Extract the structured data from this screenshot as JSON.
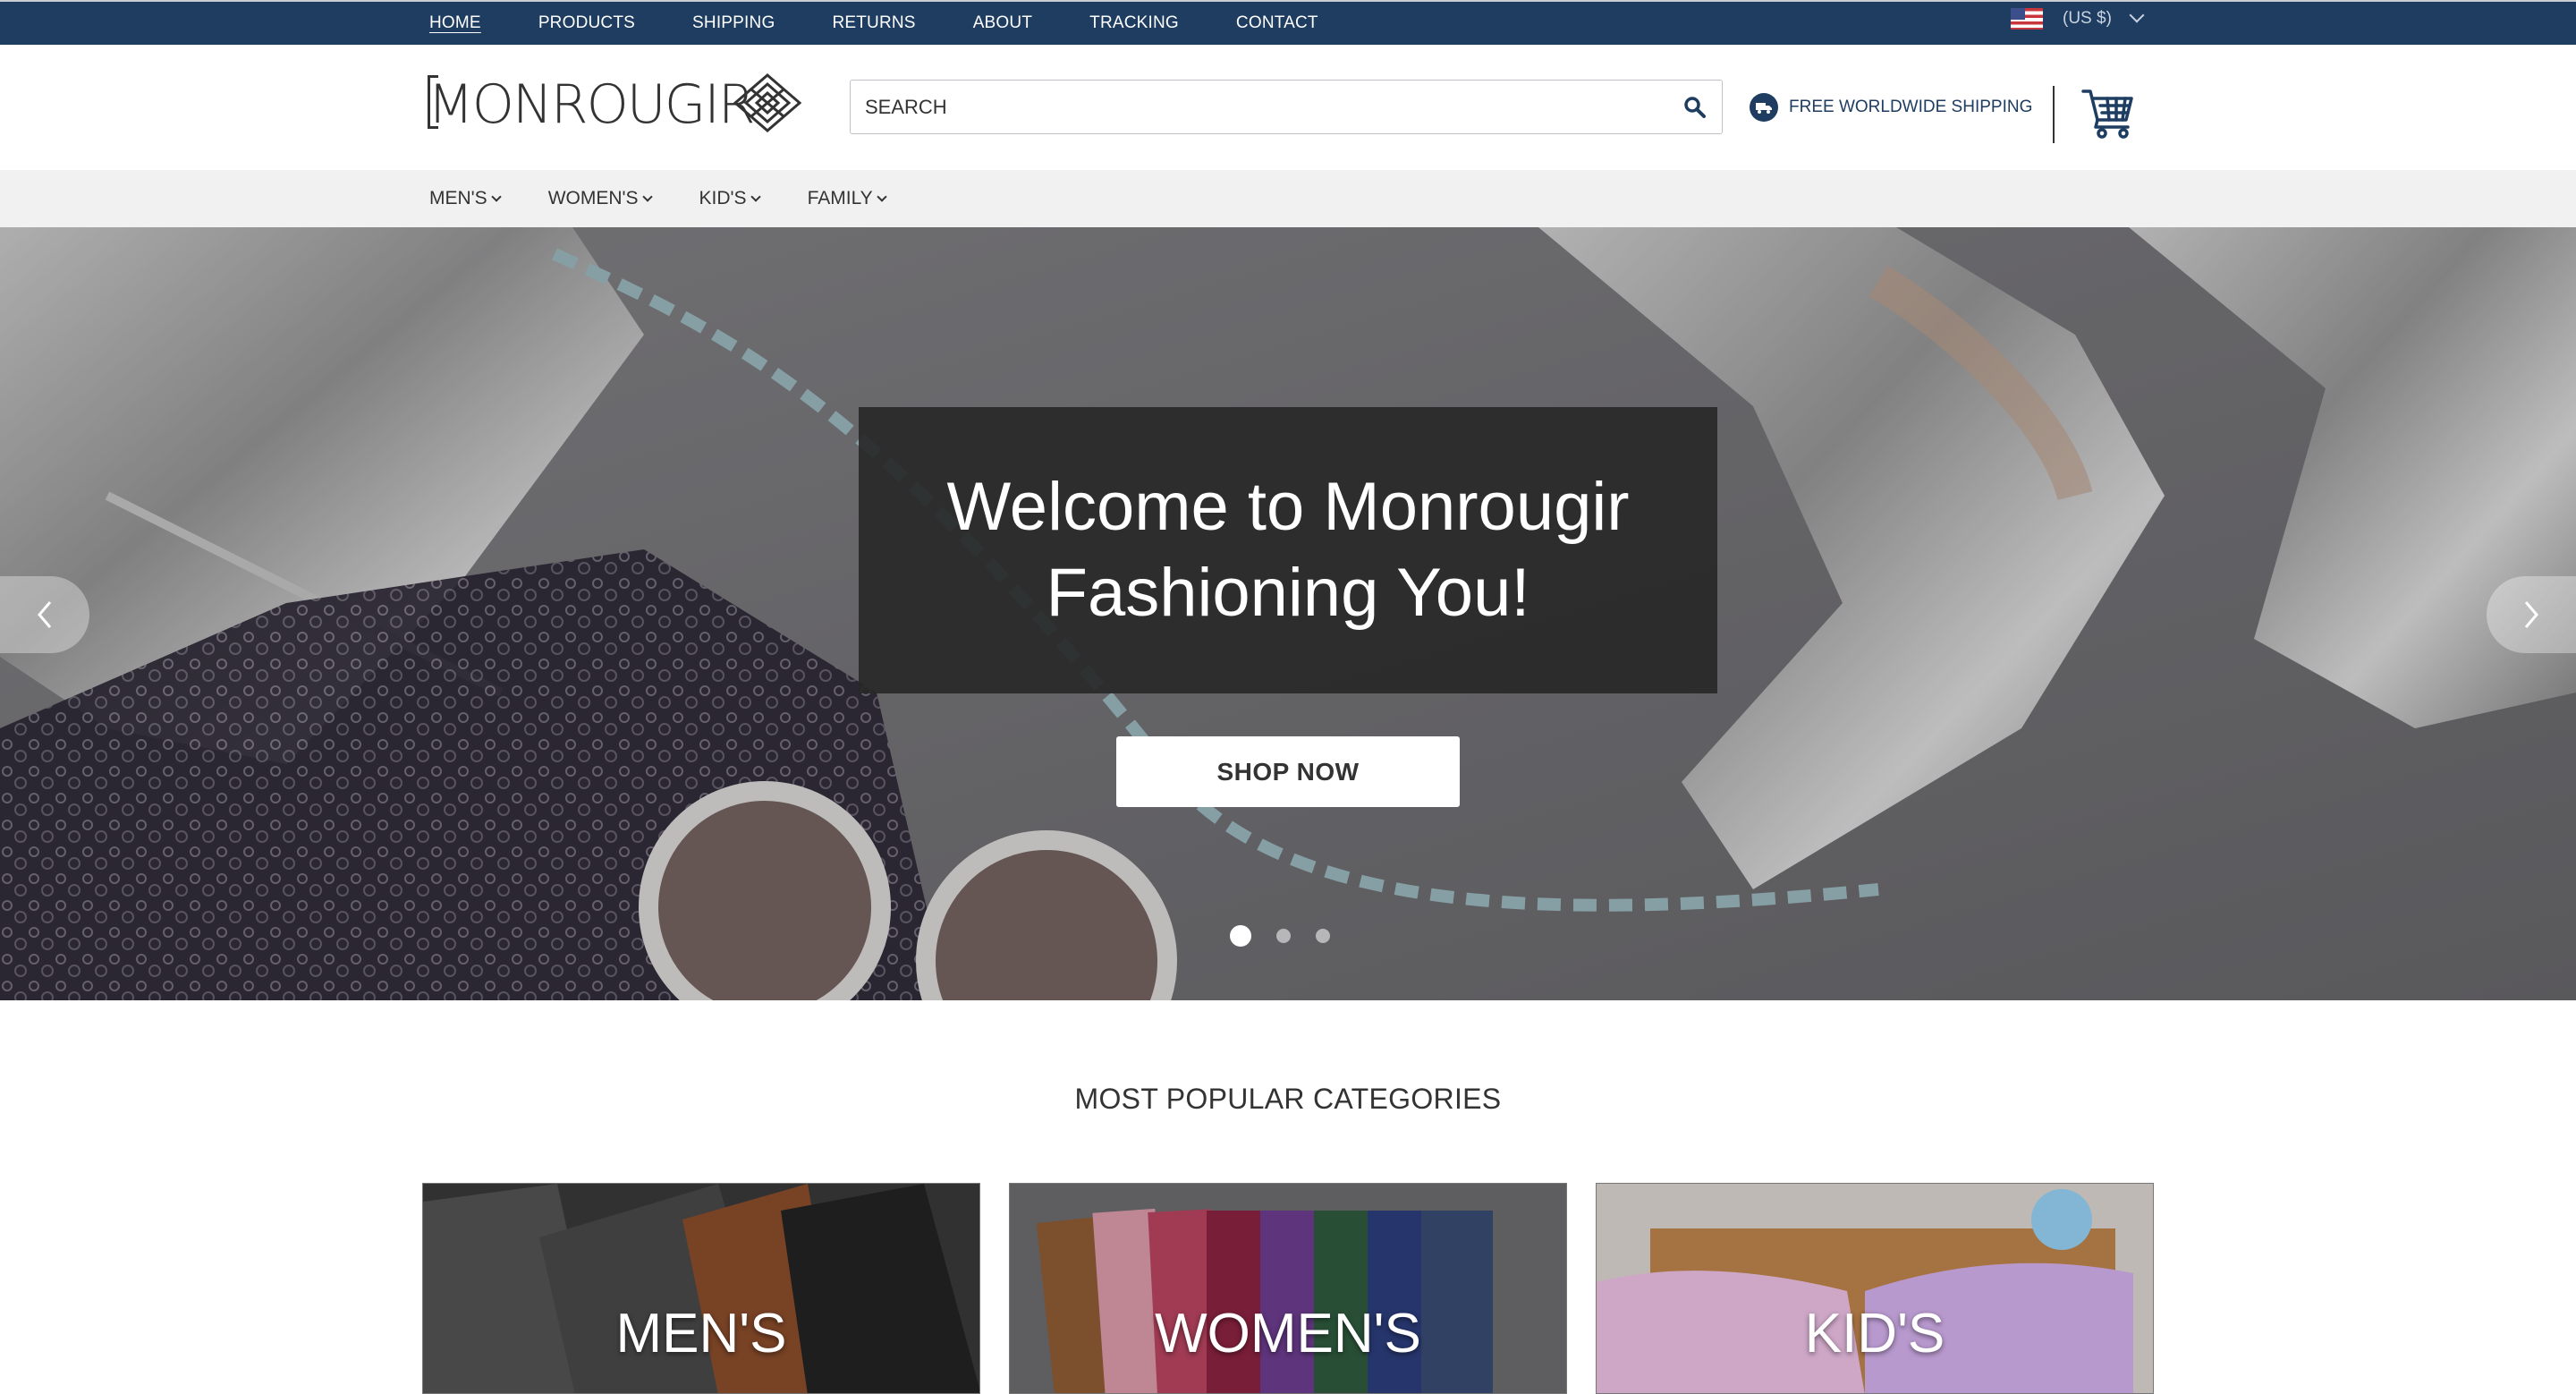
{
  "topbar": {
    "nav": [
      "HOME",
      "PRODUCTS",
      "SHIPPING",
      "RETURNS",
      "ABOUT",
      "TRACKING",
      "CONTACT"
    ],
    "currency": "(US $)",
    "flag_icon": "us-flag-icon"
  },
  "header": {
    "logo_text": "MONROUGIR",
    "search_placeholder": "SEARCH",
    "shipping_text": "FREE WORLDWIDE SHIPPING"
  },
  "categories_nav": [
    "MEN'S",
    "WOMEN'S",
    "KID'S",
    "FAMILY"
  ],
  "hero": {
    "title_line1": "Welcome to Monrougir",
    "title_line2": "Fashioning You!",
    "cta": "SHOP NOW",
    "slides": 3,
    "active_slide": 1
  },
  "popular": {
    "title": "MOST POPULAR CATEGORIES",
    "cards": [
      "MEN'S",
      "WOMEN'S",
      "KID'S"
    ]
  },
  "colors": {
    "navy": "#1e3d61",
    "catbar": "#f1f1f2",
    "overlay": "#282828"
  }
}
